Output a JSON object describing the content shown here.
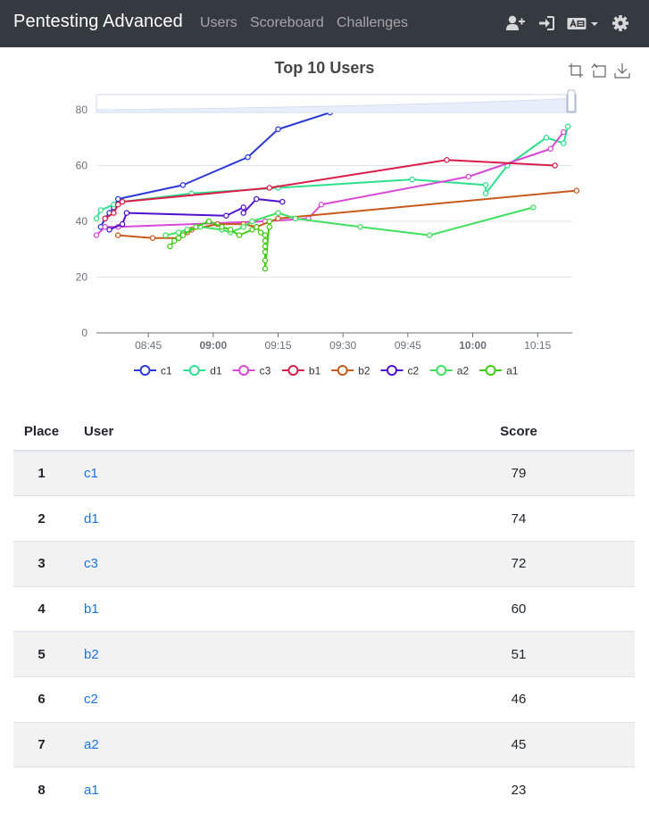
{
  "navbar": {
    "brand": "Pentesting Advanced",
    "links": [
      "Users",
      "Scoreboard",
      "Challenges"
    ],
    "icons": [
      "user-plus-icon",
      "sign-in-icon",
      "language-icon",
      "settings-gear-icon"
    ]
  },
  "chart": {
    "title": "Top 10 Users",
    "toolbox": [
      "zoom-icon",
      "restore-icon",
      "download-icon"
    ]
  },
  "chart_data": {
    "type": "line",
    "title": "Top 10 Users",
    "x_ticks": [
      "08:45",
      "09:00",
      "09:15",
      "09:30",
      "09:45",
      "10:00",
      "10:15"
    ],
    "x_ticks_bold": [
      "09:00",
      "10:00"
    ],
    "y_ticks": [
      0,
      20,
      40,
      60,
      80
    ],
    "xlim": [
      "08:33",
      "10:23"
    ],
    "ylim": [
      0,
      80
    ],
    "grid": true,
    "legend_position": "bottom",
    "data_zoom_slider": true,
    "series": [
      {
        "name": "c1",
        "color": "#2b39d9",
        "points": [
          [
            "08:34",
            38
          ],
          [
            "08:35",
            41
          ],
          [
            "08:36",
            43
          ],
          [
            "08:37",
            45
          ],
          [
            "08:38",
            48
          ],
          [
            "08:53",
            53
          ],
          [
            "09:08",
            63
          ],
          [
            "09:15",
            73
          ],
          [
            "09:27",
            79
          ]
        ]
      },
      {
        "name": "d1",
        "color": "#2ee08e",
        "points": [
          [
            "08:33",
            41
          ],
          [
            "08:34",
            44
          ],
          [
            "08:37",
            46
          ],
          [
            "08:39",
            47
          ],
          [
            "08:55",
            50
          ],
          [
            "09:15",
            52
          ],
          [
            "09:46",
            55
          ],
          [
            "10:03",
            53
          ],
          [
            "10:03",
            50
          ],
          [
            "10:08",
            60
          ],
          [
            "10:17",
            70
          ],
          [
            "10:21",
            68
          ],
          [
            "10:22",
            74
          ]
        ]
      },
      {
        "name": "c3",
        "color": "#d948d9",
        "points": [
          [
            "08:33",
            35
          ],
          [
            "08:35",
            38
          ],
          [
            "08:38",
            38
          ],
          [
            "09:12",
            40
          ],
          [
            "09:22",
            41
          ],
          [
            "09:25",
            46
          ],
          [
            "09:59",
            56
          ],
          [
            "10:18",
            66
          ],
          [
            "10:21",
            72
          ]
        ]
      },
      {
        "name": "b1",
        "color": "#d91e4a",
        "points": [
          [
            "08:35",
            41
          ],
          [
            "08:37",
            43
          ],
          [
            "08:38",
            46
          ],
          [
            "08:39",
            47
          ],
          [
            "09:13",
            52
          ],
          [
            "09:54",
            62
          ],
          [
            "10:19",
            60
          ]
        ]
      },
      {
        "name": "b2",
        "color": "#c85a1c",
        "points": [
          [
            "08:38",
            35
          ],
          [
            "08:46",
            34
          ],
          [
            "08:52",
            34
          ],
          [
            "08:54",
            36
          ],
          [
            "08:55",
            37
          ],
          [
            "09:01",
            39
          ],
          [
            "09:07",
            39
          ],
          [
            "09:10",
            38
          ],
          [
            "09:15",
            41
          ],
          [
            "10:24",
            51
          ]
        ]
      },
      {
        "name": "c2",
        "color": "#5010d0",
        "points": [
          [
            "08:36",
            37
          ],
          [
            "08:39",
            39
          ],
          [
            "08:40",
            43
          ],
          [
            "09:03",
            42
          ],
          [
            "09:07",
            45
          ],
          [
            "09:07",
            43
          ],
          [
            "09:10",
            48
          ],
          [
            "09:16",
            47
          ]
        ]
      },
      {
        "name": "a2",
        "color": "#40e060",
        "points": [
          [
            "08:49",
            35
          ],
          [
            "08:52",
            36
          ],
          [
            "08:54",
            37
          ],
          [
            "08:57",
            38
          ],
          [
            "09:02",
            37
          ],
          [
            "09:04",
            36
          ],
          [
            "09:07",
            38
          ],
          [
            "09:09",
            40
          ],
          [
            "09:15",
            43
          ],
          [
            "09:19",
            41
          ],
          [
            "09:34",
            38
          ],
          [
            "09:50",
            35
          ],
          [
            "10:14",
            45
          ]
        ]
      },
      {
        "name": "a1",
        "color": "#40cc10",
        "points": [
          [
            "08:50",
            31
          ],
          [
            "08:51",
            33
          ],
          [
            "08:52",
            34
          ],
          [
            "08:53",
            35
          ],
          [
            "08:56",
            38
          ],
          [
            "08:59",
            40
          ],
          [
            "09:02",
            38
          ],
          [
            "09:04",
            37
          ],
          [
            "09:06",
            35
          ],
          [
            "09:09",
            37
          ],
          [
            "09:10",
            38
          ],
          [
            "09:11",
            36
          ],
          [
            "09:12",
            35
          ],
          [
            "09:12",
            33
          ],
          [
            "09:12",
            31
          ],
          [
            "09:12",
            29
          ],
          [
            "09:12",
            26
          ],
          [
            "09:12",
            23
          ],
          [
            "09:13",
            40
          ],
          [
            "09:13",
            38
          ]
        ]
      }
    ]
  },
  "table": {
    "headers": {
      "place": "Place",
      "user": "User",
      "score": "Score"
    },
    "rows": [
      {
        "place": "1",
        "user": "c1",
        "score": "79"
      },
      {
        "place": "2",
        "user": "d1",
        "score": "74"
      },
      {
        "place": "3",
        "user": "c3",
        "score": "72"
      },
      {
        "place": "4",
        "user": "b1",
        "score": "60"
      },
      {
        "place": "5",
        "user": "b2",
        "score": "51"
      },
      {
        "place": "6",
        "user": "c2",
        "score": "46"
      },
      {
        "place": "7",
        "user": "a2",
        "score": "45"
      },
      {
        "place": "8",
        "user": "a1",
        "score": "23"
      }
    ]
  }
}
